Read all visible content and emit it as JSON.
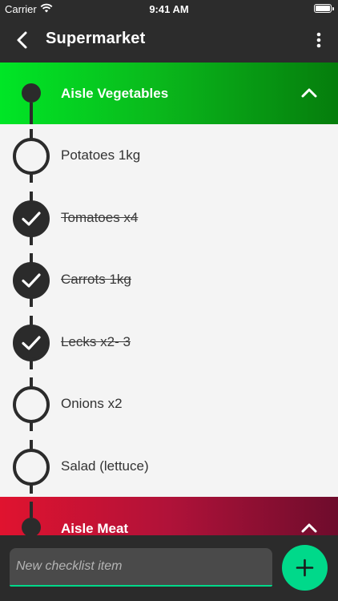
{
  "status": {
    "carrier": "Carrier",
    "time": "9:41 AM",
    "battery_level": 1.0
  },
  "toolbar": {
    "title": "Supermarket"
  },
  "aisles": [
    {
      "name": "Aisle Vegetables",
      "color_start": "#00e626",
      "color_end": "#057d0c"
    },
    {
      "name": "Aisle Meat",
      "color_start": "#e0132f",
      "color_end": "#6e0c2c"
    }
  ],
  "items": [
    {
      "label": "Potatoes 1kg",
      "checked": false
    },
    {
      "label": "Tomatoes x4",
      "checked": true
    },
    {
      "label": "Carrots 1kg",
      "checked": true
    },
    {
      "label": "Lecks x2- 3",
      "checked": true
    },
    {
      "label": "Onions x2",
      "checked": false
    },
    {
      "label": "Salad (lettuce)",
      "checked": false
    }
  ],
  "new_item": {
    "placeholder": "New checklist item",
    "value": ""
  },
  "colors": {
    "accent": "#00d98a",
    "dark": "#2b2b2b",
    "list_bg": "#f4f4f4"
  },
  "icons": {
    "back": "chevron-left-icon",
    "menu": "more-vertical-icon",
    "collapse": "chevron-up-icon",
    "add": "plus-icon",
    "check": "check-icon",
    "wifi": "wifi-icon",
    "battery": "battery-icon"
  }
}
